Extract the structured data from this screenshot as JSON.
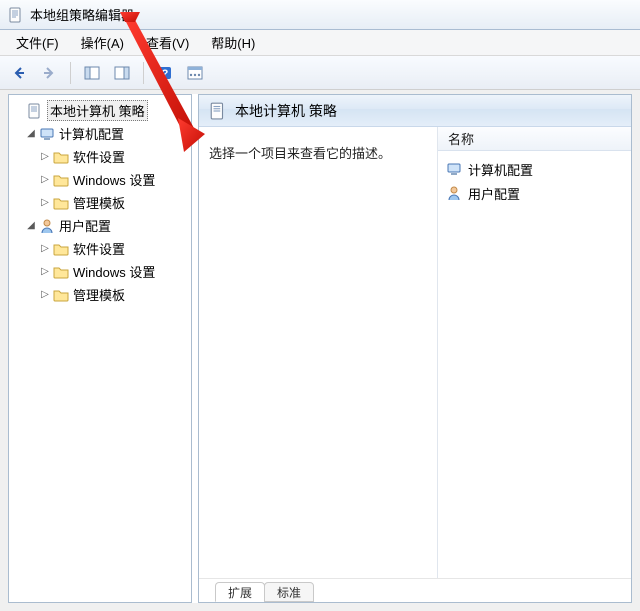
{
  "window": {
    "title": "本地组策略编辑器"
  },
  "menus": {
    "file": "文件(F)",
    "action": "操作(A)",
    "view": "查看(V)",
    "help": "帮助(H)"
  },
  "tree": {
    "root": "本地计算机 策略",
    "computer_config": "计算机配置",
    "user_config": "用户配置",
    "software": "软件设置",
    "windows": "Windows 设置",
    "admin": "管理模板"
  },
  "right": {
    "header": "本地计算机 策略",
    "desc": "选择一个项目来查看它的描述。",
    "col_name": "名称",
    "row_computer": "计算机配置",
    "row_user": "用户配置"
  },
  "tabs": {
    "extended": "扩展",
    "standard": "标准"
  }
}
